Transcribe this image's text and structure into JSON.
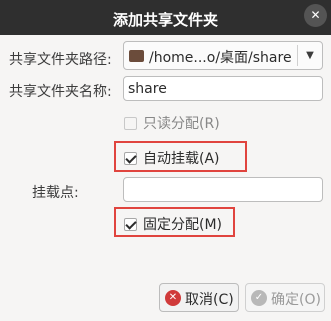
{
  "window": {
    "title": "添加共享文件夹",
    "close_glyph": "✕"
  },
  "form": {
    "path_label": "共享文件夹路径:",
    "path_value": "/home...o/桌面/share",
    "path_dropdown_glyph": "▼",
    "name_label": "共享文件夹名称:",
    "name_value": "share",
    "readonly_label": "只读分配(R)",
    "readonly_checked": false,
    "automount_label": "自动挂载(A)",
    "automount_checked": true,
    "mountpoint_label": "挂载点:",
    "mountpoint_value": "",
    "permanent_label": "固定分配(M)",
    "permanent_checked": true
  },
  "buttons": {
    "cancel_label": "取消(C)",
    "cancel_icon_glyph": "✕",
    "ok_label": "确定(O)",
    "ok_icon_glyph": "✓"
  },
  "colors": {
    "titlebar": "#2f2f2f",
    "highlight": "#e0443e",
    "cancel_icon": "#d03a3a",
    "folder_icon": "#6b4c3b"
  }
}
